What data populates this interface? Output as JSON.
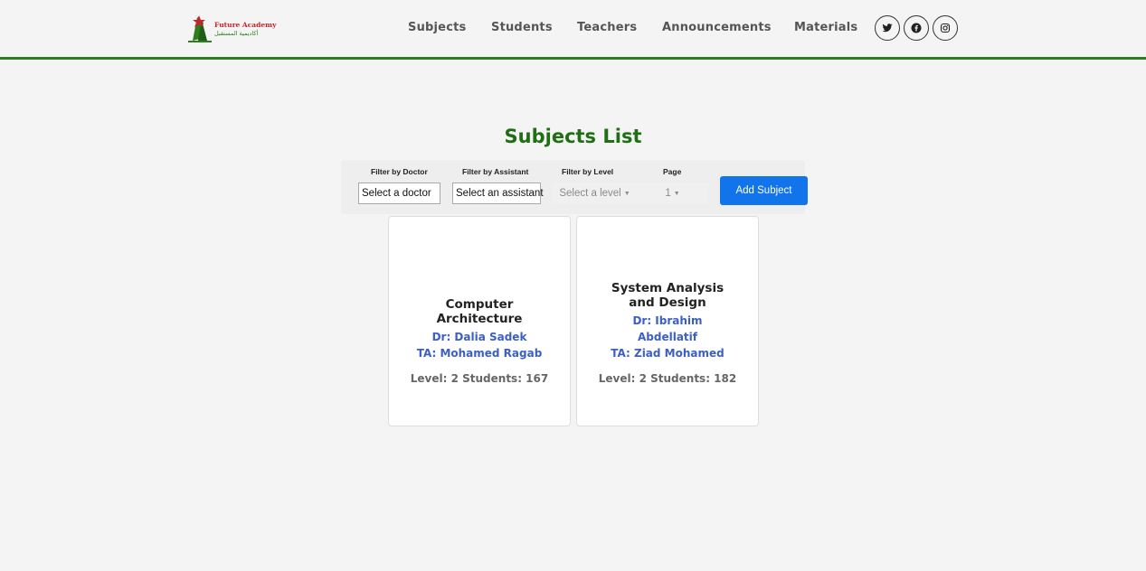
{
  "header": {
    "logo": {
      "name_en": "Future Academy",
      "name_ar": "أكاديمية المستقبل"
    },
    "nav": [
      "Subjects",
      "Students",
      "Teachers",
      "Announcements",
      "Materials"
    ],
    "social": [
      "twitter-icon",
      "facebook-icon",
      "instagram-icon"
    ],
    "border_color": "#2e7d1e"
  },
  "page": {
    "title": "Subjects List",
    "title_color": "#1f6e14"
  },
  "filters": {
    "doctor": {
      "label": "Filter by Doctor",
      "value": "Select a doctor"
    },
    "assistant": {
      "label": "Filter by Assistant",
      "value": "Select an assistant"
    },
    "level": {
      "label": "Filter by Level",
      "value": "Select a level"
    },
    "page": {
      "label": "Page",
      "value": "1"
    },
    "add_button": "Add Subject",
    "accent": "#1274ea"
  },
  "subjects": [
    {
      "title_lines": [
        "Computer",
        "Architecture"
      ],
      "doctor_lines": [
        "Dr: Dalia Sadek"
      ],
      "ta_lines": [
        "TA: Mohamed Ragab"
      ],
      "meta": "Level: 2 Students: 167"
    },
    {
      "title_lines": [
        "System Analysis",
        "and Design"
      ],
      "doctor_lines": [
        "Dr: Ibrahim",
        "Abdellatif"
      ],
      "ta_lines": [
        "TA: Ziad Mohamed"
      ],
      "meta": "Level: 2 Students: 182"
    }
  ]
}
